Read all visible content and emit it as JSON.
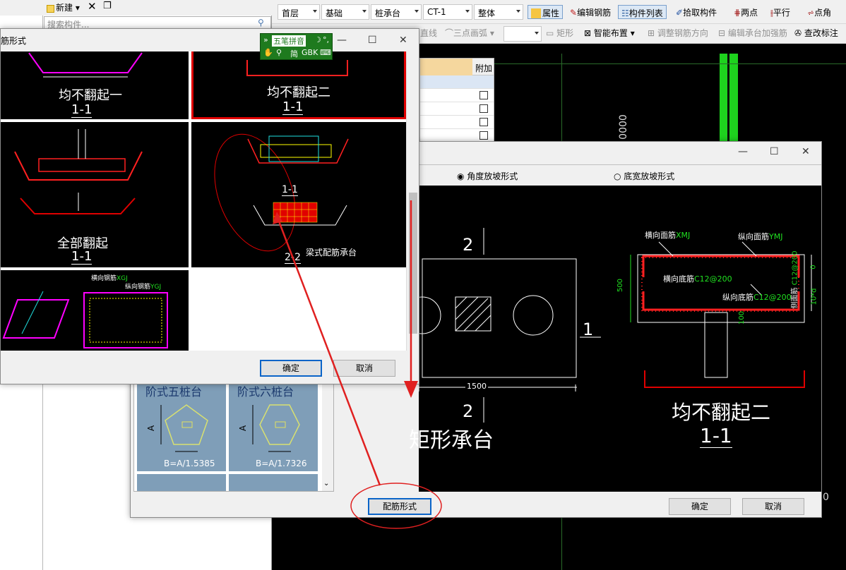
{
  "left_panel": {
    "new_label": "新建",
    "search_placeholder": "搜索构件..."
  },
  "toolbar": {
    "floor": "首层",
    "category": "基础",
    "type": "桩承台",
    "component": "CT-1",
    "scope": "整体",
    "attributes": "属性",
    "edit_rebar": "编辑钢筋",
    "component_list": "构件列表",
    "pick_component": "拾取构件",
    "two_point": "两点",
    "parallel": "平行",
    "point_angle": "点角",
    "line": "直线",
    "three_point_arc": "三点画弧",
    "rectangle": "矩形",
    "smart_layout": "智能布置",
    "adjust_rebar_dir": "调整钢筋方向",
    "edit_cap_strengthen": "编辑承台加强筋",
    "check_label": "查改标注"
  },
  "prop_grid": {
    "col_header": "附加"
  },
  "canvas": {
    "dim_text": "0000",
    "dim_right": "0"
  },
  "main_dialog": {
    "radio_angle": "角度放坡形式",
    "radio_width": "底宽放坡形式",
    "section_num_top": "2",
    "section_num_bottom": "2",
    "section_num_right": "1",
    "width_dim": "1500",
    "title_shape": "矩形承台",
    "rebar_title": "均不翻起二",
    "rebar_section": "1-1",
    "lbl_hmj": "横向面筋",
    "lbl_hmj_code": "XMJ",
    "lbl_ymj": "纵向面筋",
    "lbl_ymj_code": "YMJ",
    "lbl_hdj": "横向底筋",
    "lbl_hdj_spec": "C12@200",
    "lbl_ydj": "纵向底筋",
    "lbl_ydj_spec": "C12@200",
    "lbl_side": "侧面筋",
    "lbl_side_spec": "C12@200",
    "dim_500": "500",
    "dim_0": "0",
    "dim_10d": "10*d",
    "dim_100": "100",
    "pentagon_title": "阶式五桩台",
    "hexagon_title": "阶式六桩台",
    "pentagon_formula": "B=A/1.5385",
    "hexagon_formula": "B=A/1.7326",
    "dim_a": "A",
    "btn_rebar_form": "配筋形式",
    "btn_ok": "确定",
    "btn_cancel": "取消"
  },
  "rebar_dialog": {
    "title": "筋形式",
    "opt1_title": "均不翻起一",
    "opt1_section": "1-1",
    "opt2_title": "均不翻起二",
    "opt2_section": "1-1",
    "opt3_title": "全部翻起",
    "opt3_section": "1-1",
    "opt4_section1": "1-1",
    "opt4_section2": "2-2",
    "opt4_title": "梁式配筋承台",
    "opt5_lbl1": "横向钢筋",
    "opt5_code1": "XGJ",
    "opt5_lbl2": "纵向钢筋",
    "opt5_code2": "YGJ",
    "btn_ok": "确定",
    "btn_cancel": "取消"
  },
  "ime": {
    "name": "五笔拼音",
    "mode": "简",
    "charset": "GBK"
  },
  "colors": {
    "canvas_bg": "#000000",
    "rebar_red": "#ff2020",
    "label_green": "#20e020",
    "highlight_red": "#e00000",
    "magenta": "#ff00ff",
    "yellow": "#ffff00",
    "accent_blue": "#0a64c8"
  }
}
